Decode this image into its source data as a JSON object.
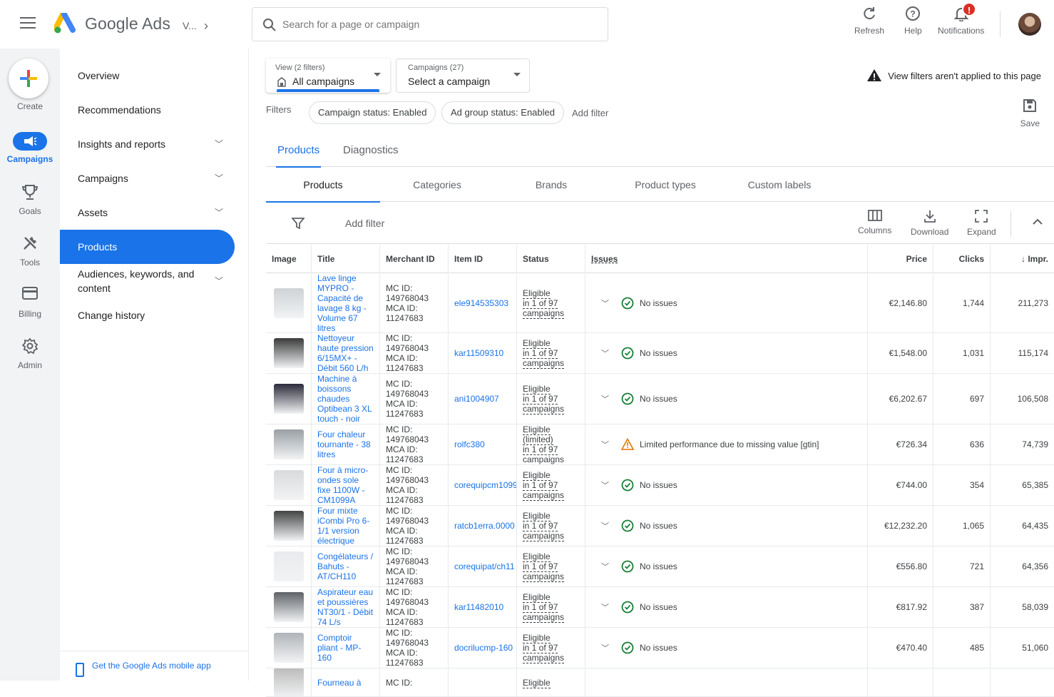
{
  "header": {
    "brand": "Google Ads",
    "account": "V...",
    "search_placeholder": "Search for a page or campaign",
    "refresh": "Refresh",
    "help": "Help",
    "notifications": "Notifications",
    "notif_badge": "!"
  },
  "rail": {
    "create": "Create",
    "campaigns": "Campaigns",
    "goals": "Goals",
    "tools": "Tools",
    "billing": "Billing",
    "admin": "Admin"
  },
  "nav": {
    "items": [
      "Overview",
      "Recommendations",
      "Insights and reports",
      "Campaigns",
      "Assets",
      "Products",
      "Audiences, keywords, and content",
      "Change history"
    ],
    "footer": "Get the Google Ads mobile app"
  },
  "toolbar": {
    "view_cap": "View (2 filters)",
    "view_val": "All campaigns",
    "camp_cap": "Campaigns (27)",
    "camp_val": "Select a campaign",
    "warning": "View filters aren't applied to this page",
    "filters_label": "Filters",
    "chip1": "Campaign status: Enabled",
    "chip2": "Ad group status: Enabled",
    "add_filter": "Add filter",
    "save": "Save"
  },
  "tabs": {
    "top": [
      "Products",
      "Diagnostics"
    ],
    "sub": [
      "Products",
      "Categories",
      "Brands",
      "Product types",
      "Custom labels"
    ]
  },
  "table_tools": {
    "add_filter": "Add filter",
    "columns": "Columns",
    "download": "Download",
    "expand": "Expand"
  },
  "table": {
    "headers": [
      "Image",
      "Title",
      "Merchant ID",
      "Item ID",
      "Status",
      "Issues",
      "Price",
      "Clicks",
      "Impr."
    ],
    "rows": [
      {
        "title": "Lave linge MYPRO - Capacité de lavage 8 kg - Volume 67 litres",
        "merchant": "MC ID:\n149768043\nMCA ID:\n11247683",
        "item": "ele914535303",
        "status_1": "Eligible",
        "status_2": "in 1 of 97 campaigns",
        "issue": "No issues",
        "issue_type": "ok",
        "price": "€2,146.80",
        "clicks": "1,744",
        "impr": "211,273"
      },
      {
        "title": "Nettoyeur haute pression 6/15MX+ - Débit 560 L/h",
        "merchant": "MC ID:\n149768043\nMCA ID:\n11247683",
        "item": "kar11509310",
        "status_1": "Eligible",
        "status_2": "in 1 of 97 campaigns",
        "issue": "No issues",
        "issue_type": "ok",
        "price": "€1,548.00",
        "clicks": "1,031",
        "impr": "115,174"
      },
      {
        "title": "Machine à boissons chaudes Optibean 3 XL touch - noir",
        "merchant": "MC ID:\n149768043\nMCA ID:\n11247683",
        "item": "ani1004907",
        "status_1": "Eligible",
        "status_2": "in 1 of 97 campaigns",
        "issue": "No issues",
        "issue_type": "ok",
        "price": "€6,202.67",
        "clicks": "697",
        "impr": "106,508"
      },
      {
        "title": "Four chaleur tournante - 38 litres",
        "merchant": "MC ID:\n149768043\nMCA ID:\n11247683",
        "item": "rolfc380",
        "status_1": "Eligible (limited)",
        "status_2": "in 1 of 97 campaigns",
        "issue": "Limited performance due to missing value [gtin]",
        "issue_type": "warn",
        "price": "€726.34",
        "clicks": "636",
        "impr": "74,739"
      },
      {
        "title": "Four à micro-ondes sole fixe 1100W - CM1099A",
        "merchant": "MC ID:\n149768043\nMCA ID:\n11247683",
        "item": "corequipcm1099",
        "status_1": "Eligible",
        "status_2": "in 1 of 97 campaigns",
        "issue": "No issues",
        "issue_type": "ok",
        "price": "€744.00",
        "clicks": "354",
        "impr": "65,385"
      },
      {
        "title": "Four mixte iCombi Pro 6-1/1 version électrique",
        "merchant": "MC ID:\n149768043\nMCA ID:\n11247683",
        "item": "ratcb1erra.0000",
        "status_1": "Eligible",
        "status_2": "in 1 of 97 campaigns",
        "issue": "No issues",
        "issue_type": "ok",
        "price": "€12,232.20",
        "clicks": "1,065",
        "impr": "64,435"
      },
      {
        "title": "Congélateurs / Bahuts - AT/CH110",
        "merchant": "MC ID:\n149768043\nMCA ID:\n11247683",
        "item": "corequipat/ch11",
        "status_1": "Eligible",
        "status_2": "in 1 of 97 campaigns",
        "issue": "No issues",
        "issue_type": "ok",
        "price": "€556.80",
        "clicks": "721",
        "impr": "64,356"
      },
      {
        "title": "Aspirateur eau et poussières NT30/1 - Débit 74 L/s",
        "merchant": "MC ID:\n149768043\nMCA ID:\n11247683",
        "item": "kar11482010",
        "status_1": "Eligible",
        "status_2": "in 1 of 97 campaigns",
        "issue": "No issues",
        "issue_type": "ok",
        "price": "€817.92",
        "clicks": "387",
        "impr": "58,039"
      },
      {
        "title": "Comptoir pliant - MP-160",
        "merchant": "MC ID:\n149768043\nMCA ID:\n11247683",
        "item": "docrilucmp-160",
        "status_1": "Eligible",
        "status_2": "in 1 of 97 campaigns",
        "issue": "No issues",
        "issue_type": "ok",
        "price": "€470.40",
        "clicks": "485",
        "impr": "51,060"
      },
      {
        "title": "Fourneau à",
        "merchant": "MC ID:",
        "item": "",
        "status_1": "Eligible",
        "status_2": "",
        "issue": "",
        "issue_type": "none",
        "price": "",
        "clicks": "",
        "impr": ""
      }
    ]
  },
  "colors": {
    "accent": "#1a73e8",
    "ok": "#188038",
    "warn": "#e37400",
    "danger": "#d93025"
  }
}
